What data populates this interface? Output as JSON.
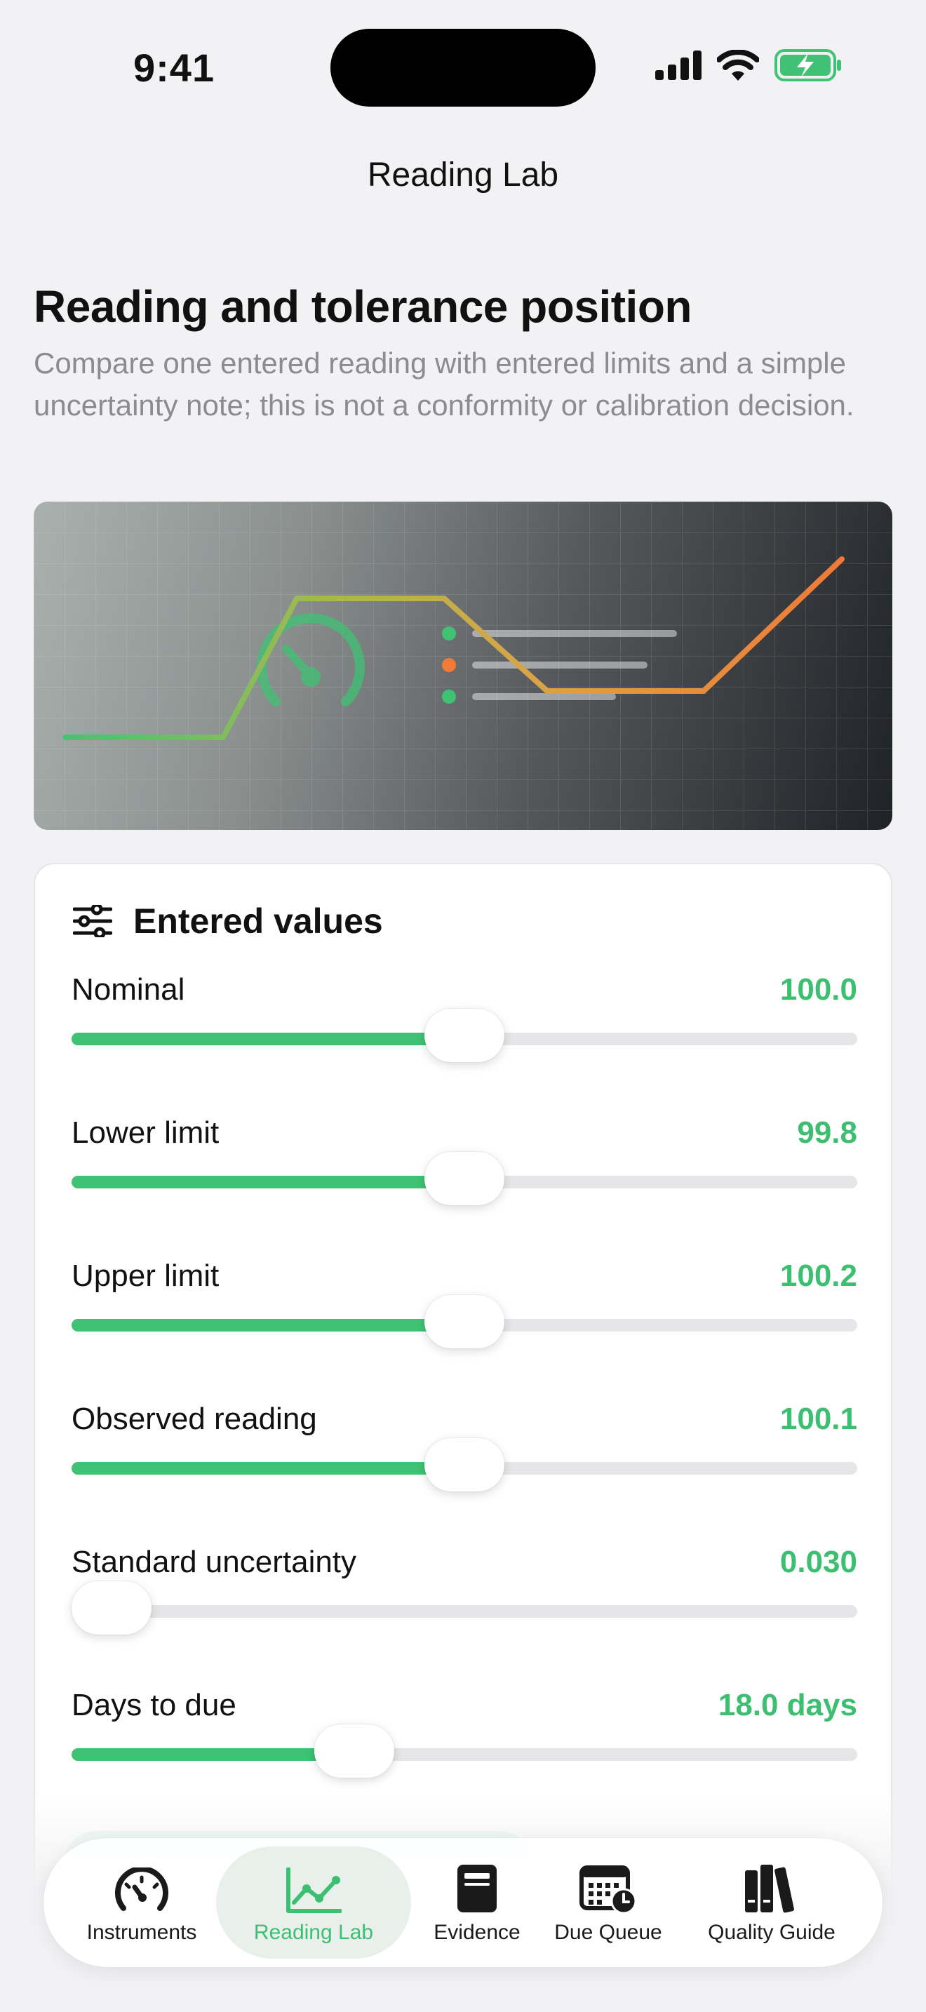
{
  "status_bar": {
    "time": "9:41"
  },
  "nav": {
    "title": "Reading Lab"
  },
  "hero": {
    "title": "Reading and tolerance position",
    "subtitle": "Compare one entered reading with entered limits and a simple uncertainty note; this is not a conformity or calibration decision."
  },
  "card": {
    "title": "Entered values",
    "icon": "sliders-icon",
    "sliders": [
      {
        "label": "Nominal",
        "value": "100.0",
        "fraction": 0.5
      },
      {
        "label": "Lower limit",
        "value": "99.8",
        "fraction": 0.5
      },
      {
        "label": "Upper limit",
        "value": "100.2",
        "fraction": 0.5
      },
      {
        "label": "Observed reading",
        "value": "100.1",
        "fraction": 0.5
      },
      {
        "label": "Standard uncertainty",
        "value": "0.030",
        "fraction": 0.0
      },
      {
        "label": "Days to due",
        "value": "18.0 days",
        "fraction": 0.36
      }
    ]
  },
  "tab_bar": {
    "active_index": 1,
    "tabs": [
      {
        "label": "Instruments",
        "icon": "speedometer-icon"
      },
      {
        "label": "Reading Lab",
        "icon": "line-chart-icon"
      },
      {
        "label": "Evidence",
        "icon": "document-icon"
      },
      {
        "label": "Due Queue",
        "icon": "calendar-clock-icon"
      },
      {
        "label": "Quality Guide",
        "icon": "books-icon"
      }
    ]
  },
  "colors": {
    "accent": "#3dbf72",
    "orange": "#f07a36",
    "background": "#f2f2f4"
  }
}
